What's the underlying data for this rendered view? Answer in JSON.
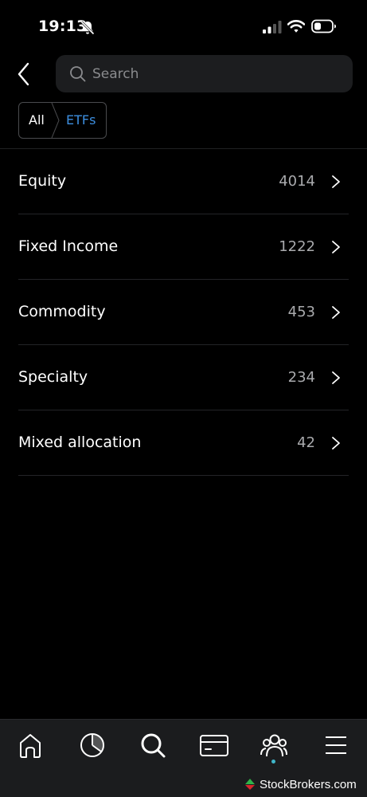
{
  "status_bar": {
    "time": "19:13",
    "icons": [
      "bell-slash-icon",
      "signal-icon",
      "wifi-icon",
      "battery-icon"
    ]
  },
  "header": {
    "back_icon": "chevron-left-icon",
    "search": {
      "placeholder": "Search",
      "value": ""
    }
  },
  "breadcrumb": {
    "items": [
      {
        "label": "All",
        "active": false
      },
      {
        "label": "ETFs",
        "active": true
      }
    ]
  },
  "categories": [
    {
      "label": "Equity",
      "count": "4014"
    },
    {
      "label": "Fixed Income",
      "count": "1222"
    },
    {
      "label": "Commodity",
      "count": "453"
    },
    {
      "label": "Specialty",
      "count": "234"
    },
    {
      "label": "Mixed allocation",
      "count": "42"
    }
  ],
  "bottom_nav": {
    "items": [
      {
        "icon": "home-icon",
        "active": false
      },
      {
        "icon": "pie-chart-icon",
        "active": false
      },
      {
        "icon": "search-icon",
        "active": true
      },
      {
        "icon": "card-icon",
        "active": false
      },
      {
        "icon": "community-icon",
        "active": false,
        "has_dot": true
      },
      {
        "icon": "menu-icon",
        "active": false
      }
    ]
  },
  "watermark": {
    "text": "StockBrokers.com"
  },
  "colors": {
    "background": "#000000",
    "accent_blue": "#3d8fe0",
    "search_bg": "#1c1d1f",
    "nav_bg": "#1b1c1e",
    "dot_teal": "#3fb6c9",
    "watermark_green": "#2fb34a",
    "watermark_red": "#d7262c"
  }
}
